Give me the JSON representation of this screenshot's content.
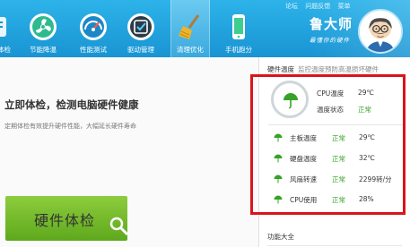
{
  "nav": {
    "items": [
      {
        "label": "体检",
        "icon": "checkup-icon"
      },
      {
        "label": "节能降温",
        "icon": "fan-icon"
      },
      {
        "label": "性能测试",
        "icon": "speedometer-icon"
      },
      {
        "label": "驱动管理",
        "icon": "driver-icon"
      },
      {
        "label": "清理优化",
        "icon": "broom-icon"
      },
      {
        "label": "手机跑分",
        "icon": "phone-icon"
      }
    ],
    "active_index": 4,
    "top_links": [
      "论坛",
      "问题反馈",
      "菜单"
    ]
  },
  "brand": {
    "name": "鲁大师",
    "slogan": "最懂你的硬件"
  },
  "main": {
    "title": "立即体检，检测电脑硬件健康",
    "subtitle": "定期体检有效提升硬件性能，大幅延长硬件寿命",
    "check_button": "硬件体检"
  },
  "panel": {
    "section_title": "硬件温度",
    "section_tail": "监控温度预防高温损坏硬件",
    "cpu_temp_label": "CPU温度",
    "cpu_temp_value": "29℃",
    "temp_state_label": "温度状态",
    "temp_state_value": "正常",
    "rows": [
      {
        "label": "主板温度",
        "status": "正常",
        "value": "29℃"
      },
      {
        "label": "硬盘温度",
        "status": "正常",
        "value": "32℃"
      },
      {
        "label": "风扇转速",
        "status": "正常",
        "value": "2299转/分"
      },
      {
        "label": "CPU使用",
        "status": "正常",
        "value": "28%"
      }
    ],
    "functions_title": "功能大全"
  },
  "colors": {
    "accent": "#1e9ad6",
    "ok": "#35a326",
    "highlight": "#d9141c",
    "button": "#6ab528"
  }
}
